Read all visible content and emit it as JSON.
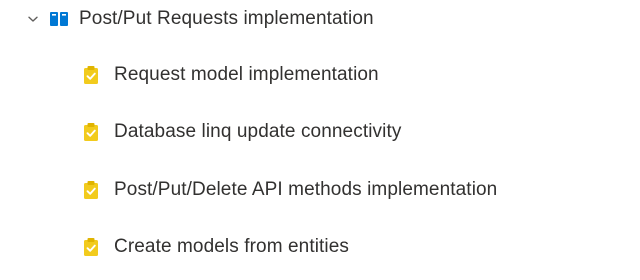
{
  "colors": {
    "epic_icon": "#0078d4",
    "task_icon": "#f2cb1d",
    "text": "#323130",
    "chevron": "#605e5c"
  },
  "tree": {
    "parent": {
      "label": "Post/Put Requests implementation",
      "expanded": true,
      "expand_icon": "chevron-down-icon",
      "type_icon": "book-icon"
    },
    "children": [
      {
        "label": "Request model implementation",
        "type_icon": "clipboard-check-icon"
      },
      {
        "label": "Database linq update connectivity",
        "type_icon": "clipboard-check-icon"
      },
      {
        "label": "Post/Put/Delete API methods implementation",
        "type_icon": "clipboard-check-icon"
      },
      {
        "label": "Create models from entities",
        "type_icon": "clipboard-check-icon"
      }
    ]
  }
}
